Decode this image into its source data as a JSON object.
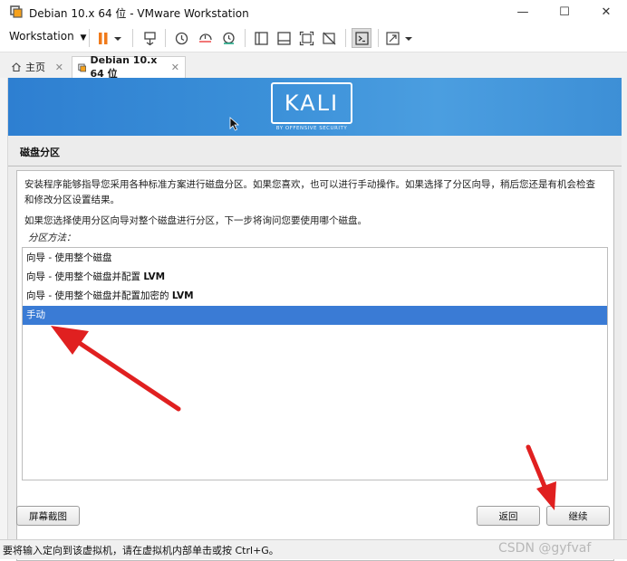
{
  "window": {
    "title": "Debian 10.x 64 位 - VMware Workstation",
    "controls": {
      "minimize": "—",
      "maximize": "☐",
      "close": "✕"
    }
  },
  "toolbar": {
    "menu_label": "Workstation",
    "icons": [
      "pause-icon",
      "send-ctrl-alt-del-icon",
      "snapshot-icon",
      "revert-snapshot-icon",
      "manage-snapshots-icon",
      "sidebar-icon",
      "thumbnail-icon",
      "fullscreen-icon",
      "unity-icon",
      "console-icon",
      "stretch-icon"
    ]
  },
  "tabs": [
    {
      "label": "主页",
      "close": "✕",
      "active": false
    },
    {
      "label": "Debian 10.x 64 位",
      "close": "✕",
      "active": true
    }
  ],
  "installer": {
    "logo_text": "KALI",
    "logo_subtitle": "BY OFFENSIVE SECURITY",
    "section_title": "磁盘分区",
    "intro": "安装程序能够指导您采用各种标准方案进行磁盘分区。如果您喜欢，也可以进行手动操作。如果选择了分区向导，稍后您还是有机会检查和修改分区设置结果。",
    "question": "如果您选择使用分区向导对整个磁盘进行分区，下一步将询问您要使用哪个磁盘。",
    "method_label": "分区方法：",
    "options": [
      {
        "prefix": "向导 - 使用整个磁盘",
        "suffix": ""
      },
      {
        "prefix": "向导 - 使用整个磁盘并配置 ",
        "suffix": "LVM"
      },
      {
        "prefix": "向导 - 使用整个磁盘并配置加密的 ",
        "suffix": "LVM"
      },
      {
        "prefix": "手动",
        "suffix": ""
      }
    ],
    "selected_index": 3,
    "buttons": {
      "screenshot": "屏幕截图",
      "back": "返回",
      "continue": "继续"
    }
  },
  "statusbar": {
    "text": "要将输入定向到该虚拟机，请在虚拟机内部单击或按 Ctrl+G。",
    "watermark": "CSDN @gyfvaf"
  },
  "colors": {
    "banner": "#3a8fd8",
    "selection": "#3a7bd5",
    "arrow": "#e02020"
  }
}
